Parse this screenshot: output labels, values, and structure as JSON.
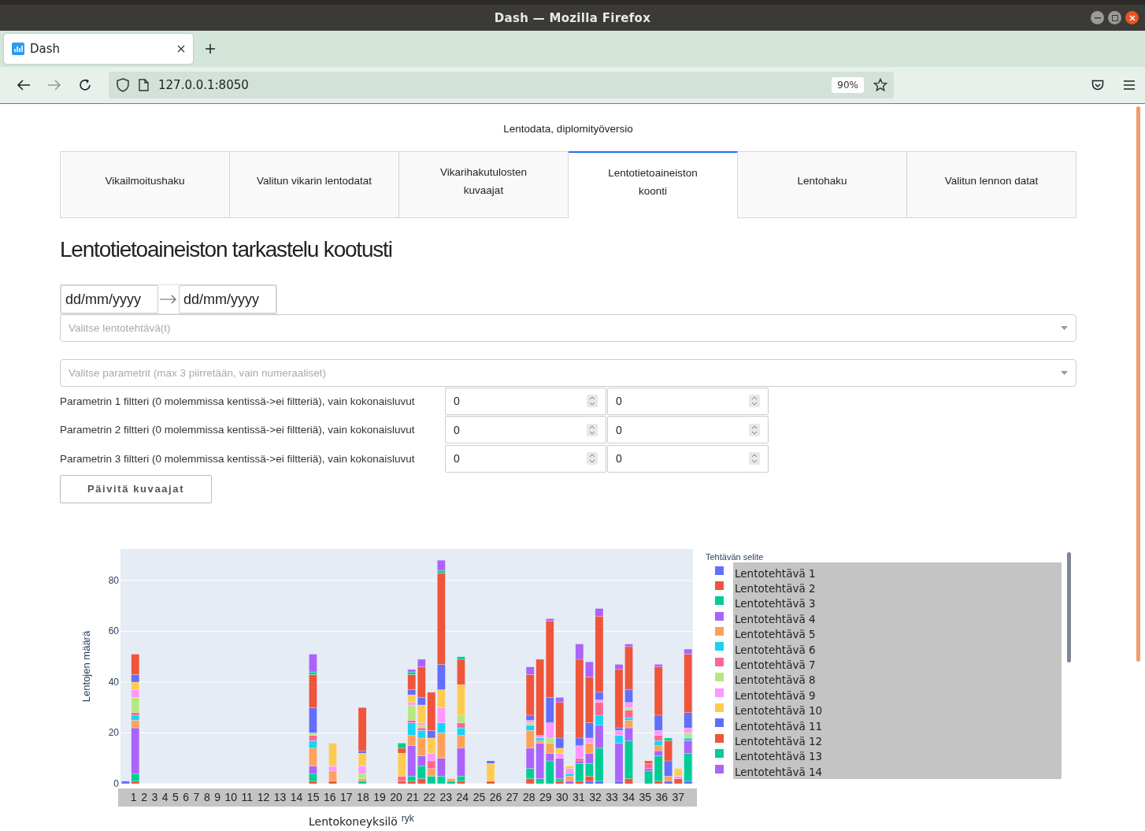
{
  "window": {
    "title": "Dash — Mozilla Firefox"
  },
  "browser": {
    "tabs": [
      {
        "label": "Dash",
        "selected": true
      }
    ],
    "address": "127.0.0.1:8050",
    "zoom": "90%"
  },
  "page": {
    "title": "Lentodata, diplomityöversio",
    "tabs": [
      {
        "label": "Vikailmoitushaku",
        "selected": false
      },
      {
        "label": "Valitun vikarin lentodatat",
        "selected": false
      },
      {
        "label": "Vikarihakutulosten\nkuvaajat",
        "selected": false
      },
      {
        "label": "Lentotietoaineiston\nkoonti",
        "selected": true
      },
      {
        "label": "Lentohaku",
        "selected": false
      },
      {
        "label": "Valitun lennon datat",
        "selected": false
      }
    ],
    "heading": "Lentotietoaineiston tarkastelu kootusti",
    "date_range": {
      "start_placeholder": "dd/mm/yyyy",
      "end_placeholder": "dd/mm/yyyy"
    },
    "task_dropdown": {
      "placeholder": "Valitse lentotehtävä(t)"
    },
    "param_dropdown": {
      "placeholder": "Valitse parametrit (max 3 piirretään, vain numeraaliset)"
    },
    "filters": [
      {
        "label": "Parametrin 1 filtteri (0 molemmissa kentissä->ei filtteriä), vain kokonaisluvut",
        "min": "0",
        "max": "0"
      },
      {
        "label": "Parametrin 2 filtteri (0 molemmissa kentissä->ei filtteriä), vain kokonaisluvut",
        "min": "0",
        "max": "0"
      },
      {
        "label": "Parametrin 3 filtteri (0 molemmissa kentissä->ei filtteriä), vain kokonaisluvut",
        "min": "0",
        "max": "0"
      }
    ],
    "update_button": "Päivitä kuvaajat",
    "chart": {
      "legend_title": "Tehtävän selite",
      "x_band": [
        "1",
        "2",
        "3",
        "4",
        "5",
        "6",
        "7",
        "8",
        "9",
        "10",
        "11",
        "12",
        "13",
        "14",
        "15",
        "16",
        "17",
        "18",
        "19",
        "20",
        "21",
        "22",
        "23",
        "24",
        "25",
        "26",
        "27",
        "28",
        "29",
        "30",
        "31",
        "32",
        "33",
        "34",
        "35",
        "36",
        "37"
      ],
      "xlabel_overlap": "ryk",
      "chart_data": {
        "type": "bar",
        "stacked": true,
        "grid": true,
        "xlabel": "Lentokoneyksilö",
        "ylabel": "Lentojen määrä",
        "ylim": [
          0,
          92.4
        ],
        "yticks": [
          0,
          20,
          40,
          60,
          80
        ],
        "series": [
          {
            "name": "Lentotehtävä 1",
            "color": "#636efa",
            "values": [
              1,
              0,
              0,
              0,
              0,
              0,
              0,
              0,
              0,
              0,
              0,
              0,
              0,
              0,
              0,
              0,
              0,
              0,
              0,
              0,
              0,
              0,
              0,
              0,
              0,
              0,
              0,
              0,
              0,
              0,
              0,
              0,
              0,
              0,
              0,
              0,
              0,
              0,
              0,
              0,
              0,
              0,
              0,
              0,
              0,
              0,
              0,
              1,
              1,
              0,
              1,
              0,
              0,
              0,
              0,
              1,
              0,
              1
            ]
          },
          {
            "name": "Lentotehtävä 2",
            "color": "#ef553b",
            "values": [
              0,
              1,
              0,
              0,
              0,
              0,
              0,
              0,
              0,
              0,
              0,
              0,
              0,
              0,
              0,
              0,
              0,
              0,
              0,
              1,
              0,
              1,
              0,
              0,
              0,
              0,
              0,
              0,
              1,
              1,
              2,
              0,
              0,
              0,
              1,
              0,
              0,
              1,
              0,
              0,
              0,
              2,
              0,
              0,
              1,
              0,
              1,
              2,
              0,
              0,
              0,
              2,
              0,
              0,
              1,
              0,
              2,
              0
            ]
          },
          {
            "name": "Lentotehtävä 3",
            "color": "#00cc96",
            "values": [
              0,
              3,
              0,
              0,
              0,
              0,
              0,
              0,
              0,
              0,
              0,
              0,
              0,
              0,
              0,
              0,
              0,
              0,
              0,
              3,
              0,
              0,
              0,
              0,
              1,
              0,
              0,
              0,
              0,
              2,
              5,
              3,
              3,
              1,
              2,
              0,
              0,
              0,
              0,
              0,
              0,
              4,
              2,
              9,
              1,
              0,
              7,
              5,
              13,
              0,
              0,
              15,
              0,
              5,
              10,
              0,
              0,
              11
            ]
          },
          {
            "name": "Lentotehtävä 4",
            "color": "#ab63fa",
            "values": [
              0,
              18,
              0,
              0,
              0,
              0,
              0,
              0,
              0,
              0,
              0,
              0,
              0,
              0,
              0,
              0,
              0,
              0,
              0,
              3,
              0,
              0,
              0,
              0,
              0,
              0,
              0,
              0,
              0,
              12,
              4,
              0,
              7,
              0,
              11,
              0,
              0,
              0,
              0,
              0,
              0,
              8,
              14,
              3,
              8,
              1,
              1,
              4,
              9,
              0,
              15,
              5,
              0,
              1,
              2,
              0,
              0,
              5
            ]
          },
          {
            "name": "Lentotehtävä 5",
            "color": "#ffa15a",
            "values": [
              0,
              3,
              0,
              0,
              0,
              0,
              0,
              0,
              0,
              0,
              0,
              0,
              0,
              0,
              0,
              0,
              0,
              0,
              0,
              7,
              0,
              4,
              0,
              0,
              1,
              0,
              0,
              0,
              0,
              4,
              7,
              3,
              10,
              1,
              5,
              0,
              0,
              0,
              0,
              0,
              0,
              7,
              1,
              4,
              0,
              2,
              0,
              4,
              0,
              0,
              0,
              3,
              0,
              0,
              2,
              2,
              0,
              0
            ]
          },
          {
            "name": "Lentotehtävä 6",
            "color": "#19d3f3",
            "values": [
              0,
              2,
              0,
              0,
              0,
              0,
              0,
              0,
              0,
              0,
              0,
              0,
              0,
              0,
              0,
              0,
              0,
              0,
              0,
              3,
              0,
              0,
              0,
              0,
              0,
              0,
              0,
              0,
              0,
              5,
              3,
              0,
              4,
              0,
              3,
              0,
              0,
              0,
              0,
              0,
              0,
              2,
              1,
              0,
              0,
              1,
              0,
              0,
              4,
              0,
              3,
              1,
              0,
              0,
              2,
              0,
              0,
              1
            ]
          },
          {
            "name": "Lentotehtävä 7",
            "color": "#ff6692",
            "values": [
              0,
              1,
              0,
              0,
              0,
              0,
              0,
              0,
              0,
              0,
              0,
              0,
              0,
              0,
              0,
              0,
              0,
              0,
              0,
              2,
              0,
              0,
              0,
              0,
              0,
              0,
              0,
              0,
              2,
              1,
              1,
              3,
              0,
              0,
              2,
              0,
              0,
              0,
              0,
              0,
              0,
              0,
              0,
              0,
              0,
              0,
              1,
              0,
              5,
              0,
              0,
              3,
              0,
              2,
              2,
              0,
              0,
              0
            ]
          },
          {
            "name": "Lentotehtävä 8",
            "color": "#b6e880",
            "values": [
              0,
              6,
              0,
              0,
              0,
              0,
              0,
              0,
              0,
              0,
              0,
              0,
              0,
              0,
              0,
              0,
              0,
              0,
              0,
              1,
              0,
              0,
              0,
              0,
              2,
              0,
              0,
              0,
              0,
              6,
              1,
              0,
              0,
              0,
              3,
              0,
              0,
              0,
              0,
              0,
              0,
              1,
              0,
              2,
              0,
              0,
              0,
              0,
              0,
              0,
              0,
              1,
              0,
              0,
              0,
              0,
              0,
              2
            ]
          },
          {
            "name": "Lentotehtävä 9",
            "color": "#ff97ff",
            "values": [
              0,
              3,
              0,
              0,
              0,
              0,
              0,
              0,
              0,
              0,
              0,
              0,
              0,
              0,
              0,
              0,
              0,
              0,
              0,
              0,
              0,
              2,
              0,
              0,
              3,
              0,
              0,
              0,
              0,
              1,
              1,
              3,
              6,
              0,
              0,
              0,
              0,
              0,
              0,
              0,
              0,
              1,
              1,
              6,
              2,
              2,
              5,
              2,
              1,
              0,
              2,
              2,
              0,
              0,
              2,
              0,
              1,
              2
            ]
          },
          {
            "name": "Lentotehtävä 10",
            "color": "#fecb52",
            "values": [
              0,
              3,
              0,
              0,
              0,
              0,
              0,
              0,
              0,
              0,
              0,
              0,
              0,
              0,
              0,
              0,
              0,
              0,
              0,
              0,
              0,
              9,
              0,
              0,
              5,
              0,
              0,
              0,
              9,
              3,
              7,
              6,
              7,
              0,
              12,
              0,
              0,
              7,
              0,
              0,
              0,
              0,
              0,
              0,
              2,
              1,
              0,
              0,
              0,
              0,
              0,
              0,
              0,
              0,
              0,
              0,
              3,
              0
            ]
          },
          {
            "name": "Lentotehtävä 11",
            "color": "#636efa",
            "values": [
              0,
              3,
              0,
              0,
              0,
              0,
              0,
              0,
              0,
              0,
              0,
              0,
              0,
              0,
              0,
              0,
              0,
              0,
              0,
              10,
              0,
              0,
              0,
              0,
              1,
              0,
              0,
              0,
              0,
              2,
              3,
              3,
              10,
              0,
              0,
              0,
              0,
              1,
              0,
              0,
              0,
              2,
              0,
              10,
              4,
              0,
              3,
              6,
              3,
              0,
              1,
              5,
              0,
              0,
              6,
              6,
              0,
              6
            ]
          },
          {
            "name": "Lentotehtävä 12",
            "color": "#ef553b",
            "values": [
              0,
              8,
              0,
              0,
              0,
              0,
              0,
              0,
              0,
              0,
              0,
              0,
              0,
              0,
              0,
              0,
              0,
              0,
              0,
              13,
              0,
              0,
              0,
              0,
              17,
              0,
              0,
              0,
              2,
              6,
              12,
              15,
              36,
              0,
              10,
              0,
              0,
              0,
              0,
              0,
              0,
              16,
              30,
              30,
              14,
              0,
              31,
              18,
              30,
              0,
              23,
              17,
              0,
              1,
              19,
              8,
              0,
              23
            ]
          },
          {
            "name": "Lentotehtävä 13",
            "color": "#00cc96",
            "values": [
              0,
              0,
              0,
              0,
              0,
              0,
              0,
              0,
              0,
              0,
              0,
              0,
              0,
              0,
              0,
              0,
              0,
              0,
              0,
              1,
              0,
              0,
              0,
              0,
              0,
              0,
              0,
              0,
              2,
              1,
              0,
              0,
              1,
              0,
              1,
              0,
              0,
              0,
              0,
              0,
              0,
              0,
              0,
              0,
              0,
              0,
              0,
              0,
              0,
              0,
              0,
              0,
              0,
              0,
              0,
              1,
              0,
              0
            ]
          },
          {
            "name": "Lentotehtävä 14",
            "color": "#ab63fa",
            "values": [
              0,
              0,
              0,
              0,
              0,
              0,
              0,
              0,
              0,
              0,
              0,
              0,
              0,
              0,
              0,
              0,
              0,
              0,
              0,
              7,
              0,
              0,
              0,
              0,
              0,
              0,
              0,
              0,
              0,
              1,
              3,
              0,
              4,
              0,
              0,
              0,
              0,
              0,
              0,
              0,
              0,
              3,
              0,
              1,
              2,
              0,
              6,
              6,
              3,
              0,
              2,
              1,
              0,
              0,
              1,
              0,
              0,
              2
            ]
          }
        ]
      }
    }
  }
}
